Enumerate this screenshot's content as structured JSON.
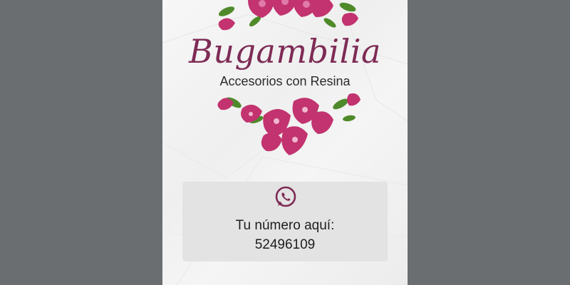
{
  "brand": {
    "name": "Bugambilia",
    "tagline": "Accesorios con Resina"
  },
  "contact": {
    "icon": "whatsapp-icon",
    "prompt": "Tu número aquí:",
    "number": "52496109"
  },
  "colors": {
    "background": "#6b6e70",
    "card": "#f3f3f3",
    "brand": "#7e2b55",
    "flower": "#c2336f",
    "leaf": "#4f8a2a",
    "contact_box": "#e3e3e3"
  }
}
